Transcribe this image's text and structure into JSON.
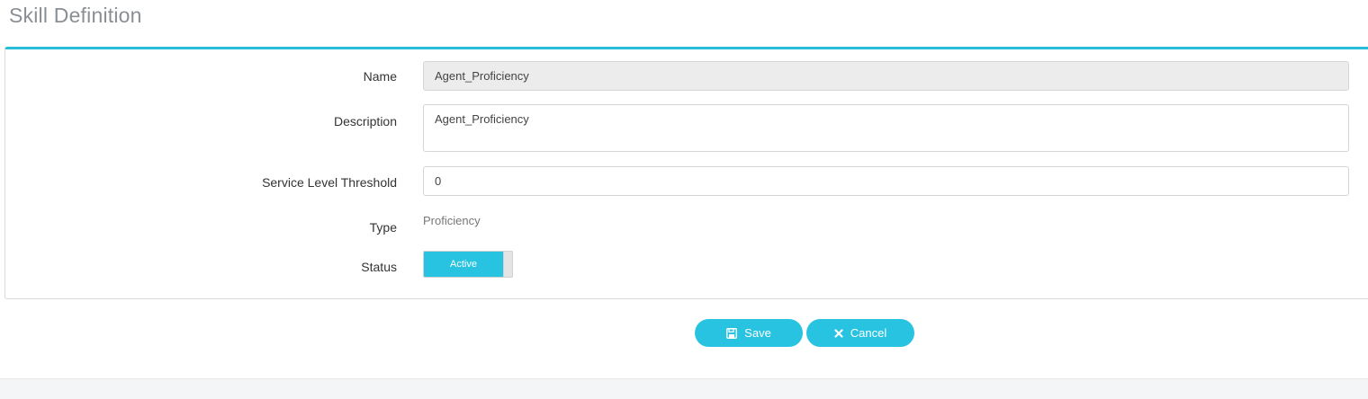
{
  "page": {
    "title": "Skill Definition"
  },
  "form": {
    "name": {
      "label": "Name",
      "value": "Agent_Proficiency"
    },
    "description": {
      "label": "Description",
      "value": "Agent_Proficiency"
    },
    "service_level_threshold": {
      "label": "Service Level Threshold",
      "value": "0"
    },
    "type": {
      "label": "Type",
      "value": "Proficiency"
    },
    "status": {
      "label": "Status",
      "value": "Active"
    }
  },
  "actions": {
    "save_label": "Save",
    "save_icon": "floppy-disk-icon",
    "cancel_label": "Cancel",
    "cancel_icon": "close-icon"
  },
  "colors": {
    "accent": "#29c3e2",
    "panel_border_top": "#29bdd9",
    "title": "#8a8f94",
    "readonly_field": "#ececec"
  }
}
